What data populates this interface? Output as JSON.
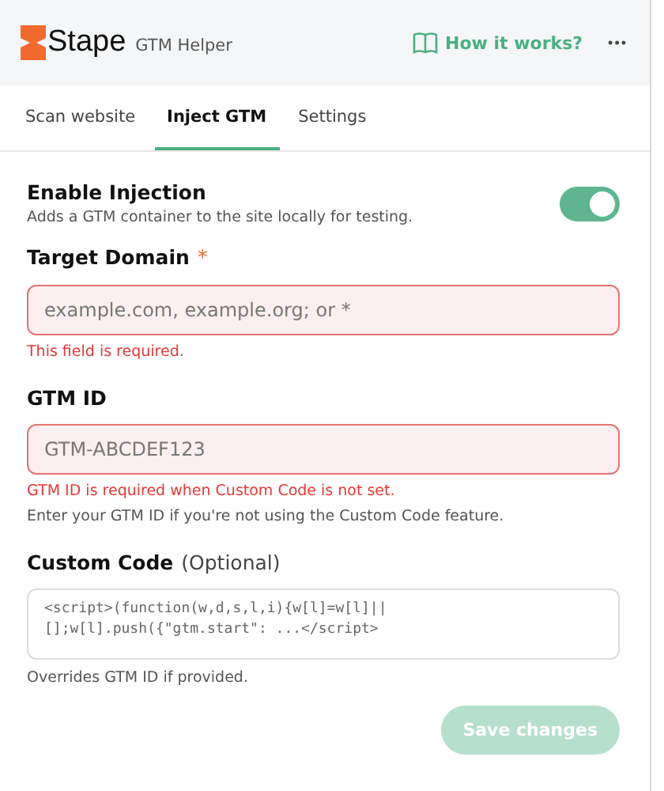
{
  "header": {
    "brand": "Stape",
    "product": "GTM Helper",
    "help_link": "How it works?",
    "menu": "•••"
  },
  "tabs": [
    {
      "label": "Scan website",
      "selected": false
    },
    {
      "label": "Inject GTM",
      "selected": true
    },
    {
      "label": "Settings",
      "selected": false
    }
  ],
  "injection": {
    "title": "Enable Injection",
    "description": "Adds a GTM container to the site locally for testing.",
    "on": true
  },
  "target_domain": {
    "label": "Target Domain",
    "required_mark": "*",
    "placeholder": "example.com, example.org; or *",
    "invalid": true,
    "error": "This field is required."
  },
  "gtm_id": {
    "label": "GTM ID",
    "placeholder": "GTM-ABCDEF123",
    "invalid": true,
    "error": "GTM ID is required when Custom Code is not set.",
    "help": "Enter your GTM ID if you're not using the Custom Code feature."
  },
  "custom_code": {
    "label": "Custom Code",
    "optional": "(Optional)",
    "placeholder": "<script>(function(w,d,s,l,i){w[l]=w[l]||[];w[l].push({\"gtm.start\": ...</script>",
    "help": "Overrides GTM ID if provided."
  },
  "save_button": {
    "label": "Save changes",
    "disabled": true
  }
}
